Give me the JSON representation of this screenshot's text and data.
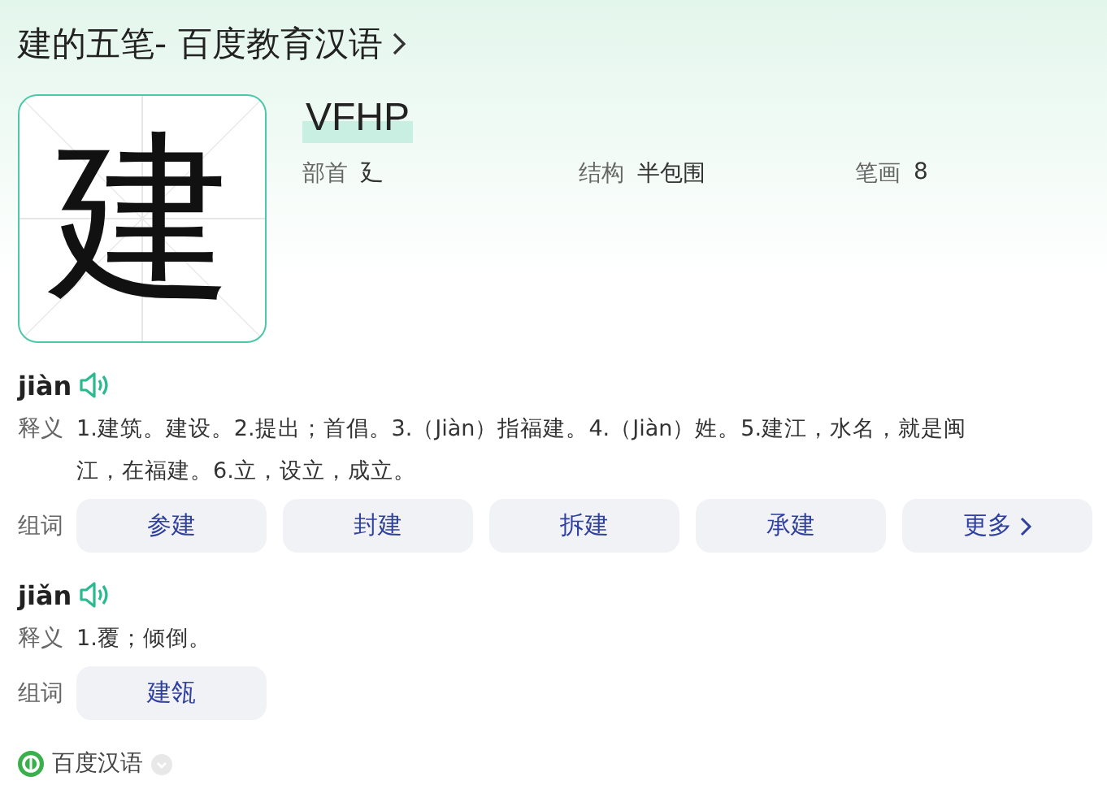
{
  "title": "建的五笔- 百度教育汉语",
  "character": "建",
  "wubi_code": "VFHP",
  "info": [
    {
      "label": "部首",
      "value": "廴"
    },
    {
      "label": "结构",
      "value": "半包围"
    },
    {
      "label": "笔画",
      "value": "8"
    }
  ],
  "readings": [
    {
      "pinyin": "jiàn",
      "definition_label": "释义",
      "definition": "1.建筑。建设。2.提出；首倡。3.（Jiàn）指福建。4.（Jiàn）姓。5.建江，水名，就是闽江，在福建。6.立，设立，成立。",
      "words_label": "组词",
      "words": [
        {
          "text": "参建",
          "kind": "word"
        },
        {
          "text": "封建",
          "kind": "word"
        },
        {
          "text": "拆建",
          "kind": "word"
        },
        {
          "text": "承建",
          "kind": "word"
        },
        {
          "text": "更多",
          "kind": "more"
        }
      ]
    },
    {
      "pinyin": "jiǎn",
      "definition_label": "释义",
      "definition": "1.覆；倾倒。",
      "words_label": "组词",
      "words": [
        {
          "text": "建瓴",
          "kind": "word"
        }
      ]
    }
  ],
  "footer": {
    "source": "百度汉语"
  }
}
